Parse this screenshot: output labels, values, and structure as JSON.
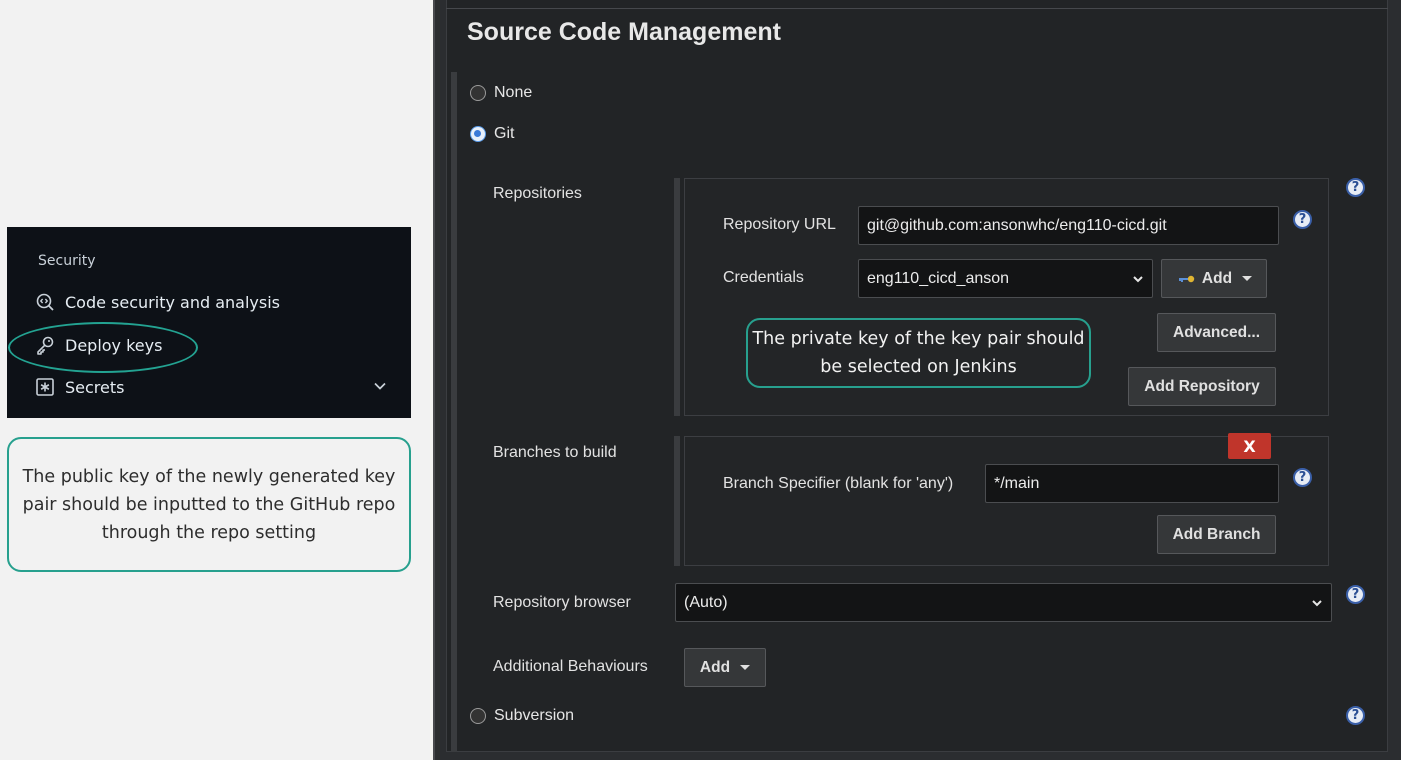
{
  "github": {
    "section_title": "Security",
    "items": [
      {
        "label": "Code security and analysis",
        "icon": "codescan-icon"
      },
      {
        "label": "Deploy keys",
        "icon": "key-icon"
      },
      {
        "label": "Secrets",
        "icon": "asterisk-box-icon"
      }
    ]
  },
  "notes": {
    "public_key": "The public key of the newly generated key pair should be inputted to the GitHub repo through the repo setting",
    "private_key": "The private key of the key pair should be selected on Jenkins"
  },
  "jenkins": {
    "title": "Source Code Management",
    "scm_options": [
      "None",
      "Git",
      "Subversion"
    ],
    "selected_scm": "Git",
    "repositories_label": "Repositories",
    "repo_url_label": "Repository URL",
    "repo_url_value": "git@github.com:ansonwhc/eng110-cicd.git",
    "credentials_label": "Credentials",
    "credentials_value": "eng110_cicd_anson",
    "add_label": "Add",
    "advanced_label": "Advanced...",
    "add_repository_label": "Add Repository",
    "branches_label": "Branches to build",
    "delete_label": "X",
    "branch_specifier_label": "Branch Specifier (blank for 'any')",
    "branch_specifier_value": "*/main",
    "add_branch_label": "Add Branch",
    "repo_browser_label": "Repository browser",
    "repo_browser_value": "(Auto)",
    "additional_behaviours_label": "Additional Behaviours",
    "help_symbol": "?"
  },
  "colors": {
    "annotation_teal": "#23a392",
    "github_bg": "#0d1117",
    "jenkins_bg": "#222426",
    "delete_red": "#c0352b"
  }
}
